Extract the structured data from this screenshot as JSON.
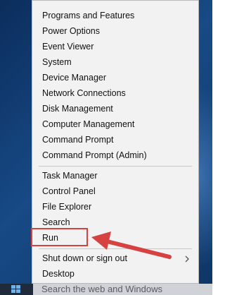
{
  "menu": {
    "group1": [
      {
        "label": "Programs and Features"
      },
      {
        "label": "Power Options"
      },
      {
        "label": "Event Viewer"
      },
      {
        "label": "System"
      },
      {
        "label": "Device Manager"
      },
      {
        "label": "Network Connections"
      },
      {
        "label": "Disk Management"
      },
      {
        "label": "Computer Management"
      },
      {
        "label": "Command Prompt"
      },
      {
        "label": "Command Prompt (Admin)"
      }
    ],
    "group2": [
      {
        "label": "Task Manager"
      },
      {
        "label": "Control Panel"
      },
      {
        "label": "File Explorer"
      },
      {
        "label": "Search"
      },
      {
        "label": "Run"
      }
    ],
    "group3": [
      {
        "label": "Shut down or sign out"
      },
      {
        "label": "Desktop"
      }
    ]
  },
  "taskbar": {
    "search_placeholder": "Search the web and Windows"
  },
  "colors": {
    "annotation": "#d64242",
    "menu_bg": "#f2f2f2",
    "taskbar": "#1f2b3a"
  },
  "icons": {
    "submenu": "chevron-right-icon",
    "start": "windows-logo-icon",
    "annotation": "arrow-icon"
  }
}
